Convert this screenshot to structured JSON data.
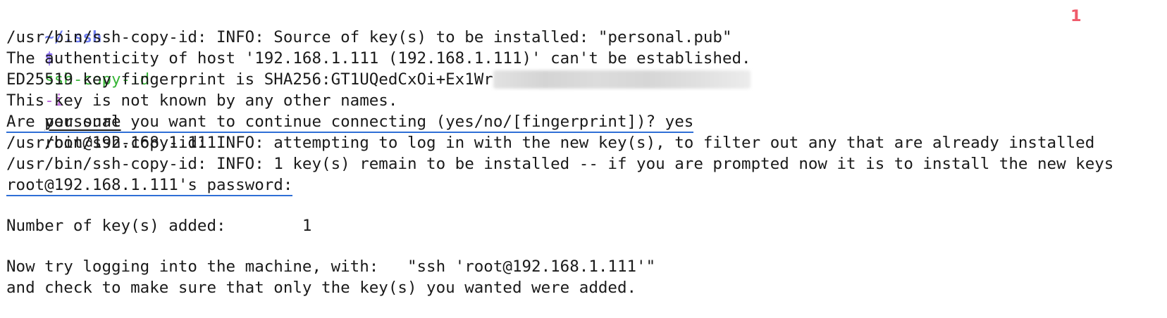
{
  "prompt": {
    "directory": "~/.ssh",
    "symbol": "$",
    "command": "ssh-copy-id",
    "flag": "-i",
    "key_arg": "personal",
    "target": "root@192.168.1.111",
    "job_count": "1"
  },
  "output": {
    "line_source": "/usr/bin/ssh-copy-id: INFO: Source of key(s) to be installed: \"personal.pub\"",
    "line_authenticity": "The authenticity of host '192.168.1.111 (192.168.1.111)' can't be established.",
    "line_fingerprint": "ED25519 key fingerprint is SHA256:GT1UQedCxOi+Ex1Wr",
    "line_not_known": "This key is not known by any other names.",
    "line_confirm": "Are you sure you want to continue connecting (yes/no/[fingerprint])? yes",
    "line_attempting": "/usr/bin/ssh-copy-id: INFO: attempting to log in with the new key(s), to filter out any that are already installed",
    "line_remain": "/usr/bin/ssh-copy-id: INFO: 1 key(s) remain to be installed -- if you are prompted now it is to install the new keys",
    "line_password": "root@192.168.1.111's password:",
    "line_added": "Number of key(s) added:        1",
    "line_try": "Now try logging into the machine, with:   \"ssh 'root@192.168.1.111'\"",
    "line_check": "and check to make sure that only the key(s) you wanted were added."
  },
  "colors": {
    "prompt_directory": "#6f7ef0",
    "command": "#36b536",
    "flag": "#b65ad8",
    "job_count": "#ef5b6b",
    "highlight_underline": "#2f6fd6"
  }
}
